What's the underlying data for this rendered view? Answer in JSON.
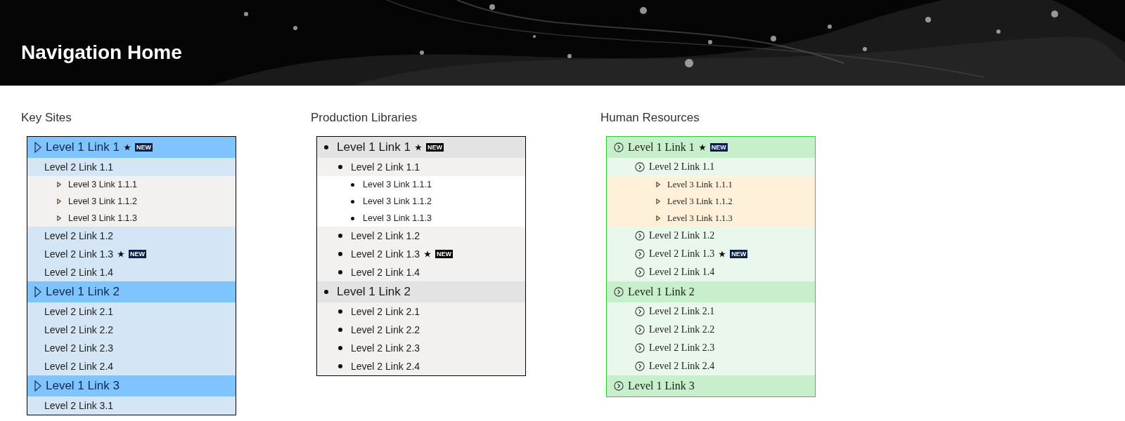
{
  "header": {
    "title": "Navigation Home"
  },
  "sections": [
    {
      "title": "Key Sites",
      "kind": "blue",
      "items": [
        {
          "label": "Level 1 Link 1",
          "starred": true,
          "badge": "NEW",
          "children": [
            {
              "label": "Level 2 Link 1.1",
              "starred": false,
              "children": [
                {
                  "label": "Level 3 Link 1.1.1",
                  "starred": false
                },
                {
                  "label": "Level 3 Link 1.1.2",
                  "starred": false
                },
                {
                  "label": "Level 3 Link 1.1.3",
                  "starred": false
                }
              ]
            },
            {
              "label": "Level 2 Link 1.2",
              "starred": false
            },
            {
              "label": "Level 2 Link 1.3",
              "starred": true,
              "badge": "NEW"
            },
            {
              "label": "Level 2 Link 1.4",
              "starred": false
            }
          ]
        },
        {
          "label": "Level 1 Link 2",
          "starred": false,
          "children": [
            {
              "label": "Level 2 Link 2.1",
              "starred": false
            },
            {
              "label": "Level 2 Link 2.2",
              "starred": false
            },
            {
              "label": "Level 2 Link 2.3",
              "starred": false
            },
            {
              "label": "Level 2 Link 2.4",
              "starred": false
            }
          ]
        },
        {
          "label": "Level 1 Link 3",
          "starred": false,
          "children": [
            {
              "label": "Level 2 Link 3.1",
              "starred": false
            }
          ]
        }
      ]
    },
    {
      "title": "Production Libraries",
      "kind": "gray",
      "items": [
        {
          "label": "Level 1 Link 1",
          "starred": true,
          "badge": "NEW",
          "children": [
            {
              "label": "Level 2 Link 1.1",
              "starred": false,
              "children": [
                {
                  "label": "Level 3 Link 1.1.1",
                  "starred": false
                },
                {
                  "label": "Level 3 Link 1.1.2",
                  "starred": false
                },
                {
                  "label": "Level 3 Link 1.1.3",
                  "starred": false
                }
              ]
            },
            {
              "label": "Level 2 Link 1.2",
              "starred": false
            },
            {
              "label": "Level 2 Link 1.3",
              "starred": true,
              "badge": "NEW"
            },
            {
              "label": "Level 2 Link 1.4",
              "starred": false
            }
          ]
        },
        {
          "label": "Level 1 Link 2",
          "starred": false,
          "children": [
            {
              "label": "Level 2 Link 2.1",
              "starred": false
            },
            {
              "label": "Level 2 Link 2.2",
              "starred": false
            },
            {
              "label": "Level 2 Link 2.3",
              "starred": false
            },
            {
              "label": "Level 2 Link 2.4",
              "starred": false
            }
          ]
        }
      ]
    },
    {
      "title": "Human Resources",
      "kind": "green",
      "items": [
        {
          "label": "Level 1 Link 1",
          "starred": true,
          "badge": "NEW",
          "children": [
            {
              "label": "Level 2 Link 1.1",
              "starred": false,
              "children": [
                {
                  "label": "Level 3 Link 1.1.1",
                  "starred": false
                },
                {
                  "label": "Level 3 Link 1.1.2",
                  "starred": false
                },
                {
                  "label": "Level 3 Link 1.1.3",
                  "starred": false
                }
              ]
            },
            {
              "label": "Level 2 Link 1.2",
              "starred": false
            },
            {
              "label": "Level 2 Link 1.3",
              "starred": true,
              "badge": "NEW"
            },
            {
              "label": "Level 2 Link 1.4",
              "starred": false
            }
          ]
        },
        {
          "label": "Level 1 Link 2",
          "starred": false,
          "children": [
            {
              "label": "Level 2 Link 2.1",
              "starred": false
            },
            {
              "label": "Level 2 Link 2.2",
              "starred": false
            },
            {
              "label": "Level 2 Link 2.3",
              "starred": false
            },
            {
              "label": "Level 2 Link 2.4",
              "starred": false
            }
          ]
        },
        {
          "label": "Level 1 Link 3",
          "starred": false
        }
      ]
    }
  ]
}
